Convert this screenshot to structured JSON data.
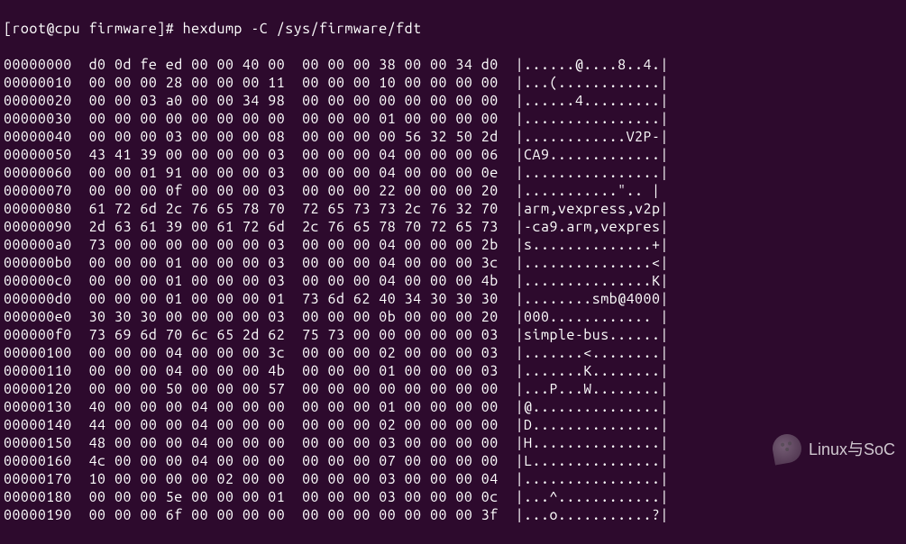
{
  "prompt": {
    "user_host": "[root@cpu firmware]#",
    "command": "hexdump -C /sys/firmware/fdt"
  },
  "hexdump": {
    "rows": [
      {
        "offset": "00000000",
        "hex1": "d0 0d fe ed 00 00 40 00",
        "hex2": "00 00 00 38 00 00 34 d0",
        "ascii": "|......@....8..4.|"
      },
      {
        "offset": "00000010",
        "hex1": "00 00 00 28 00 00 00 11",
        "hex2": "00 00 00 10 00 00 00 00",
        "ascii": "|...(............|"
      },
      {
        "offset": "00000020",
        "hex1": "00 00 03 a0 00 00 34 98",
        "hex2": "00 00 00 00 00 00 00 00",
        "ascii": "|......4.........|"
      },
      {
        "offset": "00000030",
        "hex1": "00 00 00 00 00 00 00 00",
        "hex2": "00 00 00 01 00 00 00 00",
        "ascii": "|................|"
      },
      {
        "offset": "00000040",
        "hex1": "00 00 00 03 00 00 00 08",
        "hex2": "00 00 00 00 56 32 50 2d",
        "ascii": "|............V2P-|"
      },
      {
        "offset": "00000050",
        "hex1": "43 41 39 00 00 00 00 03",
        "hex2": "00 00 00 04 00 00 00 06",
        "ascii": "|CA9.............|"
      },
      {
        "offset": "00000060",
        "hex1": "00 00 01 91 00 00 00 03",
        "hex2": "00 00 00 04 00 00 00 0e",
        "ascii": "|................|"
      },
      {
        "offset": "00000070",
        "hex1": "00 00 00 0f 00 00 00 03",
        "hex2": "00 00 00 22 00 00 00 20",
        "ascii": "|...........\".. |"
      },
      {
        "offset": "00000080",
        "hex1": "61 72 6d 2c 76 65 78 70",
        "hex2": "72 65 73 73 2c 76 32 70",
        "ascii": "|arm,vexpress,v2p|"
      },
      {
        "offset": "00000090",
        "hex1": "2d 63 61 39 00 61 72 6d",
        "hex2": "2c 76 65 78 70 72 65 73",
        "ascii": "|-ca9.arm,vexpres|"
      },
      {
        "offset": "000000a0",
        "hex1": "73 00 00 00 00 00 00 03",
        "hex2": "00 00 00 04 00 00 00 2b",
        "ascii": "|s..............+|"
      },
      {
        "offset": "000000b0",
        "hex1": "00 00 00 01 00 00 00 03",
        "hex2": "00 00 00 04 00 00 00 3c",
        "ascii": "|...............<|"
      },
      {
        "offset": "000000c0",
        "hex1": "00 00 00 01 00 00 00 03",
        "hex2": "00 00 00 04 00 00 00 4b",
        "ascii": "|...............K|"
      },
      {
        "offset": "000000d0",
        "hex1": "00 00 00 01 00 00 00 01",
        "hex2": "73 6d 62 40 34 30 30 30",
        "ascii": "|........smb@4000|"
      },
      {
        "offset": "000000e0",
        "hex1": "30 30 30 00 00 00 00 03",
        "hex2": "00 00 00 0b 00 00 00 20",
        "ascii": "|000............ |"
      },
      {
        "offset": "000000f0",
        "hex1": "73 69 6d 70 6c 65 2d 62",
        "hex2": "75 73 00 00 00 00 00 03",
        "ascii": "|simple-bus......|"
      },
      {
        "offset": "00000100",
        "hex1": "00 00 00 04 00 00 00 3c",
        "hex2": "00 00 00 02 00 00 00 03",
        "ascii": "|.......<........|"
      },
      {
        "offset": "00000110",
        "hex1": "00 00 00 04 00 00 00 4b",
        "hex2": "00 00 00 01 00 00 00 03",
        "ascii": "|.......K........|"
      },
      {
        "offset": "00000120",
        "hex1": "00 00 00 50 00 00 00 57",
        "hex2": "00 00 00 00 00 00 00 00",
        "ascii": "|...P...W........|"
      },
      {
        "offset": "00000130",
        "hex1": "40 00 00 00 04 00 00 00",
        "hex2": "00 00 00 01 00 00 00 00",
        "ascii": "|@...............|"
      },
      {
        "offset": "00000140",
        "hex1": "44 00 00 00 04 00 00 00",
        "hex2": "00 00 00 02 00 00 00 00",
        "ascii": "|D...............|"
      },
      {
        "offset": "00000150",
        "hex1": "48 00 00 00 04 00 00 00",
        "hex2": "00 00 00 03 00 00 00 00",
        "ascii": "|H...............|"
      },
      {
        "offset": "00000160",
        "hex1": "4c 00 00 00 04 00 00 00",
        "hex2": "00 00 00 07 00 00 00 00",
        "ascii": "|L...............|"
      },
      {
        "offset": "00000170",
        "hex1": "10 00 00 00 00 02 00 00",
        "hex2": "00 00 00 03 00 00 00 04",
        "ascii": "|................|"
      },
      {
        "offset": "00000180",
        "hex1": "00 00 00 5e 00 00 00 01",
        "hex2": "00 00 00 03 00 00 00 0c",
        "ascii": "|...^............|"
      },
      {
        "offset": "00000190",
        "hex1": "00 00 00 6f 00 00 00 00",
        "hex2": "00 00 00 00 00 00 00 3f",
        "ascii": "|...o...........?|"
      }
    ]
  },
  "watermark": {
    "text": "Linux与SoC"
  }
}
